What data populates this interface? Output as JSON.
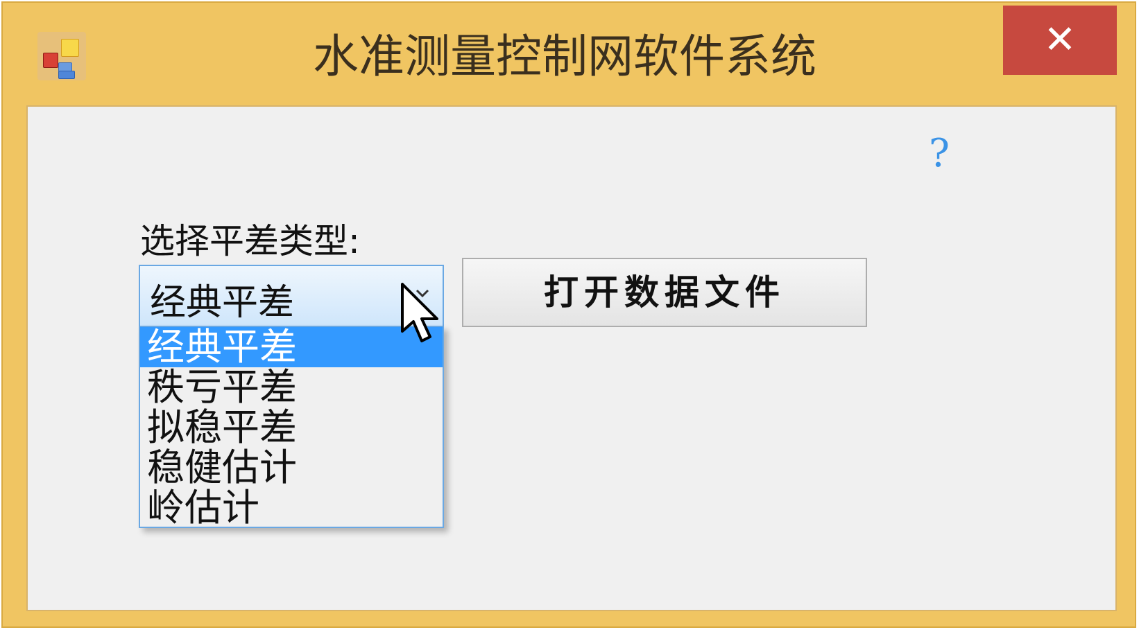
{
  "window": {
    "title": "水准测量控制网软件系统",
    "close_label": "✕",
    "colors": {
      "frame": "#f0c562",
      "close_bg": "#c7493f",
      "client_bg": "#f0f0f0",
      "selection": "#3399ff",
      "help": "#3b93e6"
    }
  },
  "form": {
    "help_label": "?",
    "select_label": "选择平差类型:",
    "combo": {
      "selected_value": "经典平差",
      "arrow_icon": "chevron-down-icon",
      "options": [
        {
          "label": "经典平差"
        },
        {
          "label": "秩亏平差"
        },
        {
          "label": "拟稳平差"
        },
        {
          "label": "稳健估计"
        },
        {
          "label": "岭估计"
        }
      ]
    },
    "open_button_label": "打开数据文件"
  }
}
